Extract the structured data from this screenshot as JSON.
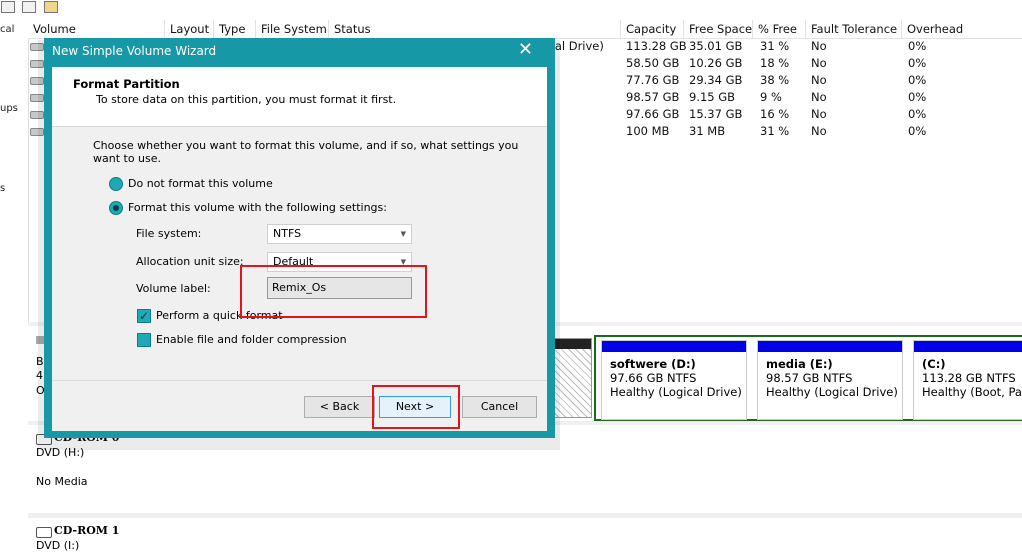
{
  "volume_table": {
    "columns": [
      "Volume",
      "Layout",
      "Type",
      "File System",
      "Status",
      "Capacity",
      "Free Space",
      "% Free",
      "Fault Tolerance",
      "Overhead"
    ],
    "rows": [
      {
        "status": "gical Drive)",
        "capacity": "113.28 GB",
        "free": "35.01 GB",
        "pct": "31 %",
        "fault": "No",
        "overhead": "0%"
      },
      {
        "status": "",
        "capacity": "58.50 GB",
        "free": "10.26 GB",
        "pct": "18 %",
        "fault": "No",
        "overhead": "0%"
      },
      {
        "status": "",
        "capacity": "77.76 GB",
        "free": "29.34 GB",
        "pct": "38 %",
        "fault": "No",
        "overhead": "0%"
      },
      {
        "status": "",
        "capacity": "98.57 GB",
        "free": "9.15 GB",
        "pct": "9 %",
        "fault": "No",
        "overhead": "0%"
      },
      {
        "status": "",
        "capacity": "97.66 GB",
        "free": "15.37 GB",
        "pct": "16 %",
        "fault": "No",
        "overhead": "0%"
      },
      {
        "status": ")",
        "capacity": "100 MB",
        "free": "31 MB",
        "pct": "31 %",
        "fault": "No",
        "overhead": "0%"
      }
    ]
  },
  "sidebar_fragments": [
    "cal",
    "ups",
    "s"
  ],
  "disk_label_fragments": [
    "B",
    "4",
    "O"
  ],
  "partitions": [
    {
      "name": "softwere  (D:)",
      "size": "97.66 GB NTFS",
      "status": "Healthy (Logical Drive)"
    },
    {
      "name": "media  (E:)",
      "size": "98.57 GB NTFS",
      "status": "Healthy (Logical Drive)"
    },
    {
      "name": "(C:)",
      "size": "113.28 GB NTFS",
      "status": "Healthy (Boot, Page"
    }
  ],
  "cdrom0": {
    "title": "CD-ROM 0",
    "drive": "DVD (H:)",
    "media": "No Media"
  },
  "cdrom1": {
    "title": "CD-ROM 1",
    "drive": "DVD (I:)"
  },
  "wizard": {
    "title": "New Simple Volume Wizard",
    "close": "✕",
    "header_title": "Format Partition",
    "header_subtitle": "To store data on this partition, you must format it first.",
    "description": "Choose whether you want to format this volume, and if so, what settings you want to use.",
    "radio_no_format": "Do not format this volume",
    "radio_format": "Format this volume with the following settings:",
    "file_system_label": "File system:",
    "file_system_value": "NTFS",
    "alloc_label": "Allocation unit size:",
    "alloc_value": "Default",
    "volume_label_label": "Volume label:",
    "volume_label_value": "Remix_Os",
    "quick_format": "Perform a quick format",
    "compression": "Enable file and folder compression",
    "back": "< Back",
    "next": "Next >",
    "cancel": "Cancel"
  },
  "colors": {
    "dialog_frame": "#1798a6",
    "radio_fill": "#1fa8b5",
    "partition_bar": "#0000e8",
    "highlight": "#e3141b"
  }
}
